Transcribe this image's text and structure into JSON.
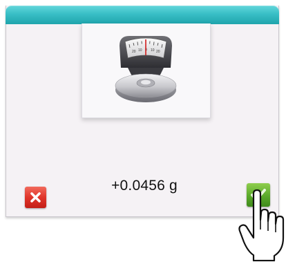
{
  "dialog": {
    "readout": {
      "value": "+0.0456 g"
    },
    "illustration": {
      "icon": "scale-icon",
      "dial_ticks": [
        "20",
        "10",
        "0",
        "10",
        "20"
      ]
    },
    "actions": {
      "cancel": {
        "icon": "close-icon",
        "color": "#e0352a"
      },
      "confirm": {
        "icon": "check-icon",
        "color": "#5aa92a"
      }
    },
    "title_bar": {
      "color": "#39bfc6"
    }
  },
  "cursor": {
    "icon": "hand-pointer-icon"
  }
}
